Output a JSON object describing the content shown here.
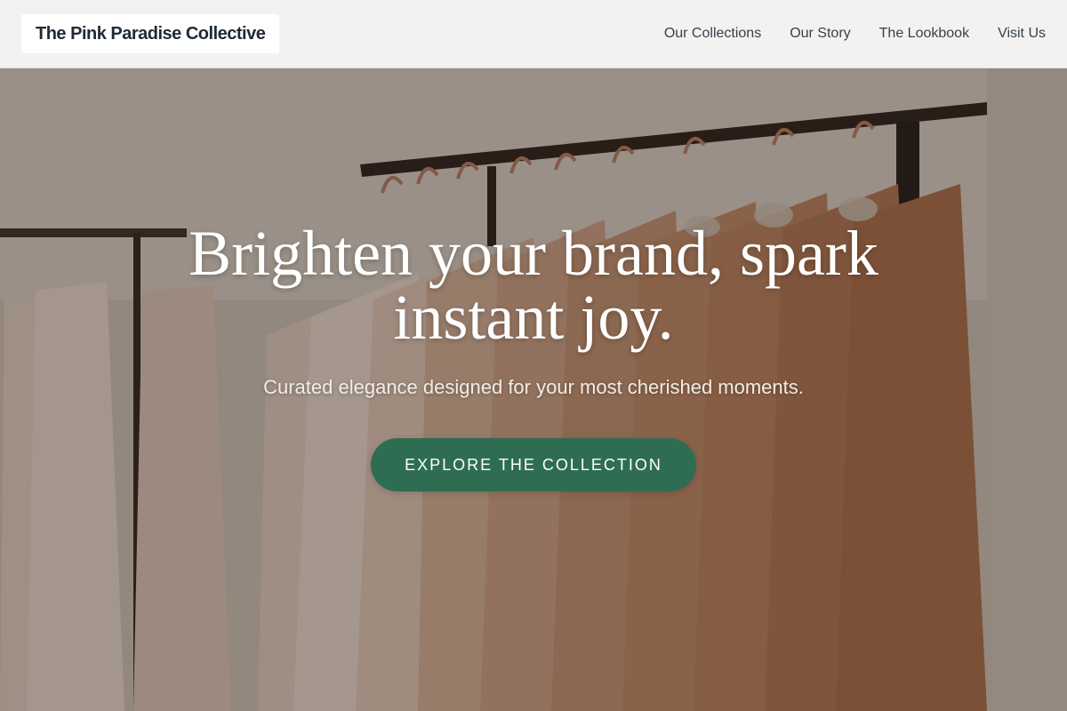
{
  "brand": {
    "name": "The Pink Paradise Collective"
  },
  "nav": {
    "links": [
      {
        "label": "Our Collections"
      },
      {
        "label": "Our Story"
      },
      {
        "label": "The Lookbook"
      },
      {
        "label": "Visit Us"
      }
    ]
  },
  "hero": {
    "title": "Brighten your brand, spark instant joy.",
    "subtitle": "Curated elegance designed for your most cherished moments.",
    "cta_label": "EXPLORE THE COLLECTION",
    "background_image": "clothing-rack-photo"
  },
  "colors": {
    "nav_background": "#f4f2f0",
    "logo_text": "#1f2a36",
    "nav_text": "#37404a",
    "cta_background": "#2f6d52",
    "hero_text": "#ffffff"
  }
}
